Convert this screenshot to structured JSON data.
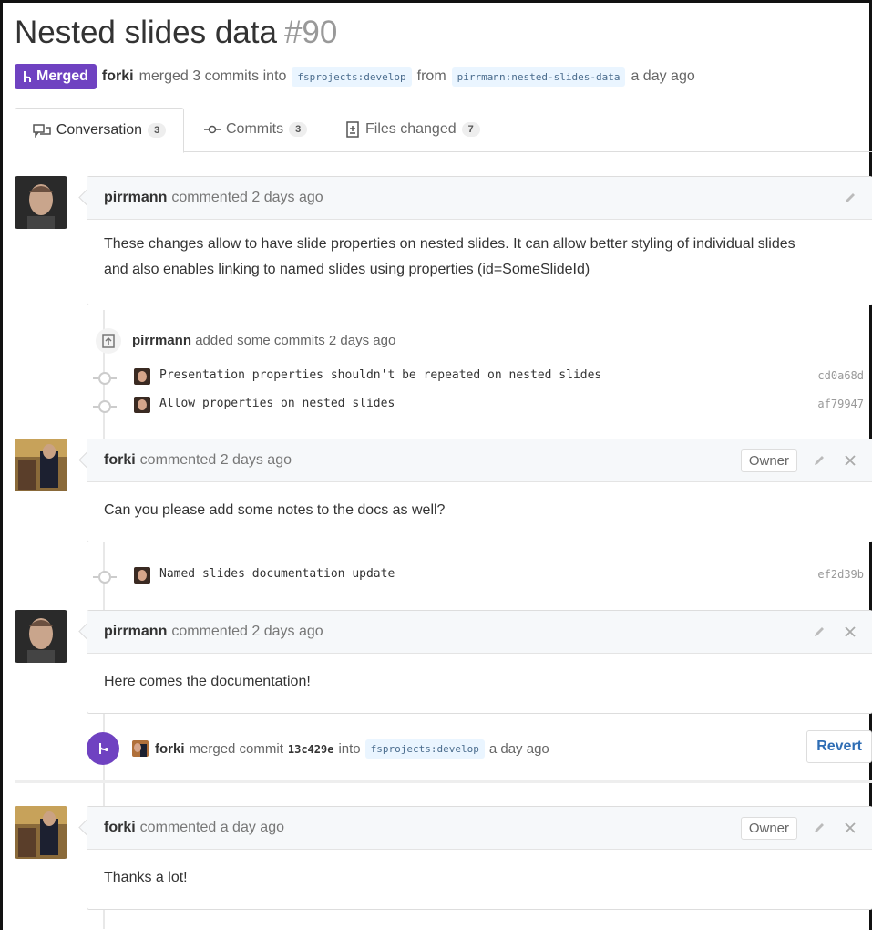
{
  "header": {
    "title": "Nested slides data",
    "number": "#90",
    "state": "Merged",
    "author": "forki",
    "action_text": "merged 3 commits into",
    "base_branch": "fsprojects:develop",
    "from_text": "from",
    "head_branch": "pirrmann:nested-slides-data",
    "time": "a day ago"
  },
  "tabs": [
    {
      "label": "Conversation",
      "count": "3",
      "icon": "comment-discussion-icon"
    },
    {
      "label": "Commits",
      "count": "3",
      "icon": "git-commit-icon"
    },
    {
      "label": "Files changed",
      "count": "7",
      "icon": "diff-icon"
    }
  ],
  "timeline": {
    "comment1": {
      "author": "pirrmann",
      "meta": "commented 2 days ago",
      "body_line1": "These changes allow to have slide properties on nested slides. It can allow better styling of individual slides",
      "body_line2": "and also enables linking to named slides using properties (id=SomeSlideId)"
    },
    "push_event": {
      "author": "pirrmann",
      "text": "added some commits 2 days ago",
      "commits": [
        {
          "message": "Presentation properties shouldn't be repeated on nested slides",
          "sha": "cd0a68d"
        },
        {
          "message": "Allow properties on nested slides",
          "sha": "af79947"
        }
      ]
    },
    "comment2": {
      "author": "forki",
      "meta": "commented 2 days ago",
      "owner_label": "Owner",
      "body": "Can you please add some notes to the docs as well?"
    },
    "commit3": {
      "message": "Named slides documentation update",
      "sha": "ef2d39b"
    },
    "comment3": {
      "author": "pirrmann",
      "meta": "commented 2 days ago",
      "body": "Here comes the documentation!"
    },
    "merge_event": {
      "author": "forki",
      "text": "merged commit",
      "sha": "13c429e",
      "into_text": "into",
      "branch": "fsprojects:develop",
      "time": "a day ago",
      "revert_label": "Revert"
    },
    "comment4": {
      "author": "forki",
      "meta": "commented a day ago",
      "owner_label": "Owner",
      "body": "Thanks a lot!"
    }
  },
  "colors": {
    "merged": "#6f42c1",
    "link": "#2e6db4",
    "branch_bg": "#eaf5ff"
  }
}
